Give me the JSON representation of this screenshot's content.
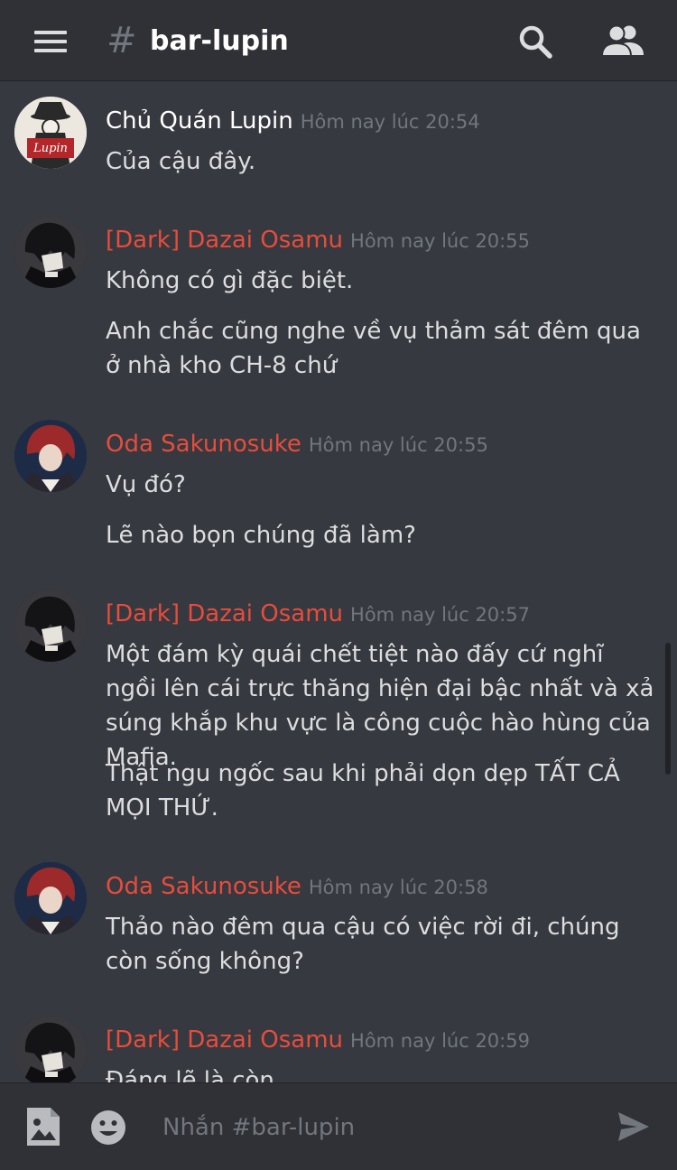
{
  "header": {
    "hash_symbol": "#",
    "channel_name": "bar-lupin",
    "menu_icon": "hamburger-menu-icon",
    "search_icon": "search-icon",
    "members_icon": "members-icon"
  },
  "colors": {
    "background": "#36393f",
    "header_bg": "#2f3136",
    "owner_name": "#ffffff",
    "role_red": "#e74c3c",
    "text": "#dcddde",
    "muted": "#72767d"
  },
  "messages": [
    {
      "author": "Chủ Quán Lupin",
      "time": "Hôm nay lúc 20:54",
      "avatar_text": "Lupin",
      "lines": [
        "Của cậu đây."
      ]
    },
    {
      "author": "[Dark] Dazai Osamu",
      "time": "Hôm nay lúc 20:55",
      "lines": [
        "Không có gì đặc biệt.",
        "Anh chắc cũng nghe về vụ thảm sát đêm qua ở nhà kho CH-8 chứ"
      ]
    },
    {
      "author": "Oda Sakunosuke",
      "time": "Hôm nay lúc 20:55",
      "lines": [
        "Vụ đó?",
        "Lẽ nào bọn chúng đã làm?"
      ]
    },
    {
      "author": "[Dark] Dazai Osamu",
      "time": "Hôm nay lúc 20:57",
      "lines": [
        "Một đám kỳ quái chết tiệt nào đấy cứ nghĩ ngồi lên cái trực thăng hiện đại bậc nhất và xả súng khắp khu vực là công cuộc hào hùng của Mafia.",
        "Thật ngu ngốc sau khi phải dọn dẹp TẤT CẢ MỌI THỨ."
      ]
    },
    {
      "author": "Oda Sakunosuke",
      "time": "Hôm nay lúc 20:58",
      "lines": [
        "Thảo nào đêm qua cậu có việc rời đi, chúng còn sống không?"
      ]
    },
    {
      "author": "[Dark] Dazai Osamu",
      "time": "Hôm nay lúc 20:59",
      "lines": [
        "Đáng lẽ là còn"
      ]
    }
  ],
  "composer": {
    "placeholder": "Nhắn #bar-lupin",
    "image_icon": "image-upload-icon",
    "emoji_icon": "emoji-icon",
    "send_icon": "send-icon"
  }
}
